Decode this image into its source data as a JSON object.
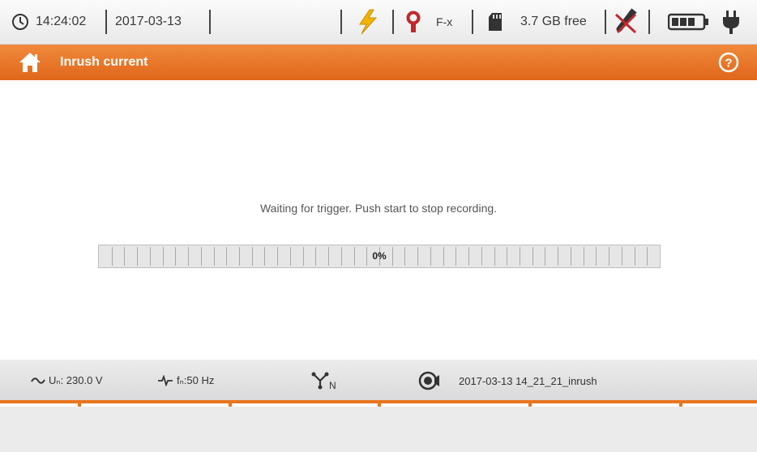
{
  "status": {
    "time": "14:24:02",
    "date": "2017-03-13",
    "clamp_label": "F-x",
    "memory_free": "3.7 GB free"
  },
  "header": {
    "title": "Inrush current"
  },
  "main": {
    "message": "Waiting for trigger. Push start to stop recording.",
    "progress_label": "0%",
    "progress_fraction": 0.0
  },
  "info_bar": {
    "voltage": "Uₙ: 230.0 V",
    "frequency": "fₙ:50 Hz",
    "network_label": "N",
    "recording_name": "2017-03-13 14_21_21_inrush"
  },
  "colors": {
    "accent": "#e8751f",
    "lightning": "#f0b400",
    "clamp": "#c0282d"
  }
}
